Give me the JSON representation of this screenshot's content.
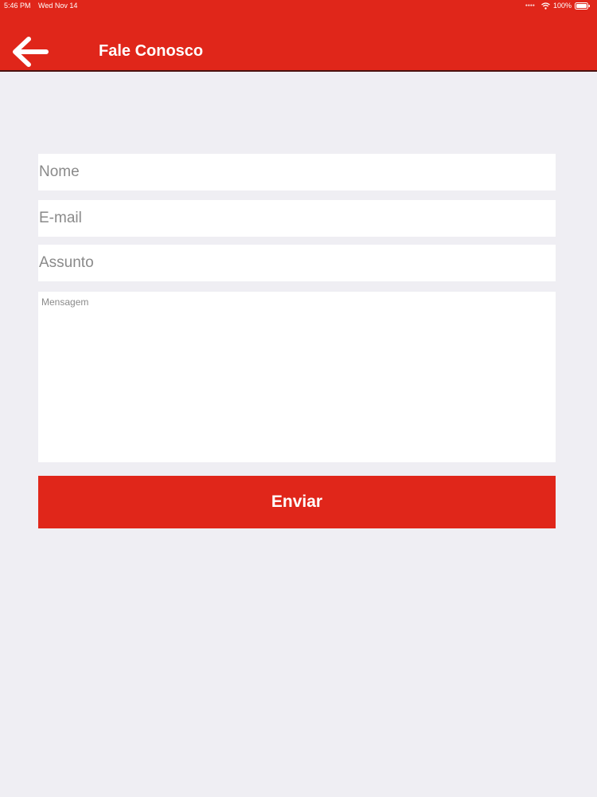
{
  "status_bar": {
    "time": "5:46 PM",
    "date": "Wed Nov 14",
    "battery": "100%",
    "icons": [
      "signal-icon",
      "wifi-icon",
      "battery-icon"
    ]
  },
  "header": {
    "title": "Fale Conosco",
    "back_icon": "arrow-left-icon"
  },
  "form": {
    "name_placeholder": "Nome",
    "email_placeholder": "E-mail",
    "subject_placeholder": "Assunto",
    "message_placeholder": "Mensagem",
    "submit_label": "Enviar"
  },
  "colors": {
    "accent": "#E0261A",
    "background": "#EFEEF3",
    "field_background": "#FFFFFF",
    "placeholder_text": "#8A8A8A"
  }
}
